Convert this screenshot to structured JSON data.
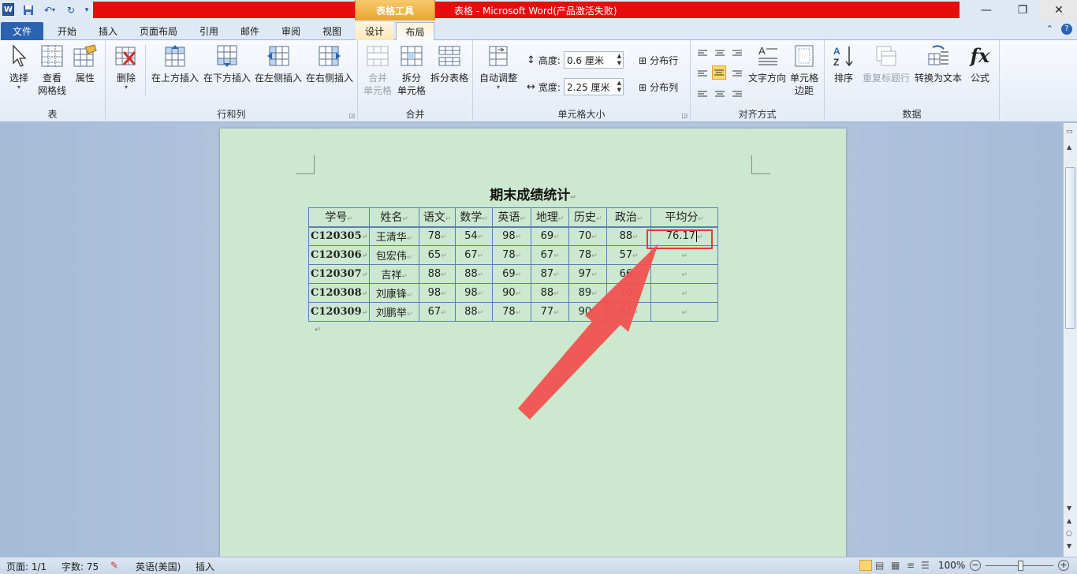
{
  "titlebar": {
    "logo": "W",
    "context_group": "表格工具",
    "window_title": "表格 - Microsoft Word(产品激活失败)",
    "minimize": "—",
    "restore": "❐",
    "close": "✕"
  },
  "tabs": {
    "file": "文件",
    "home": "开始",
    "insert": "插入",
    "page_layout": "页面布局",
    "references": "引用",
    "mailings": "邮件",
    "review": "审阅",
    "view": "视图",
    "design": "设计",
    "layout": "布局"
  },
  "ribbon": {
    "table_group": {
      "label": "表",
      "select": "选择",
      "gridlines_1": "查看",
      "gridlines_2": "网格线",
      "properties": "属性"
    },
    "rows_cols_group": {
      "label": "行和列",
      "delete": "删除",
      "insert_above": "在上方插入",
      "insert_below": "在下方插入",
      "insert_left": "在左侧插入",
      "insert_right": "在右侧插入"
    },
    "merge_group": {
      "label": "合并",
      "merge_1": "合并",
      "merge_2": "单元格",
      "split_1": "拆分",
      "split_2": "单元格",
      "split_table": "拆分表格"
    },
    "cell_size_group": {
      "label": "单元格大小",
      "autofit": "自动调整",
      "height_label": "高度:",
      "height_value": "0.6 厘米",
      "width_label": "宽度:",
      "width_value": "2.25 厘米",
      "distribute_rows": "分布行",
      "distribute_cols": "分布列"
    },
    "align_group": {
      "label": "对齐方式",
      "text_direction": "文字方向",
      "cell_margins_1": "单元格",
      "cell_margins_2": "边距"
    },
    "data_group": {
      "label": "数据",
      "sort": "排序",
      "repeat_header": "重复标题行",
      "convert_text": "转换为文本",
      "formula": "公式"
    }
  },
  "document": {
    "title": "期末成绩统计",
    "headers": [
      "学号",
      "姓名",
      "语文",
      "数学",
      "英语",
      "地理",
      "历史",
      "政治",
      "平均分"
    ],
    "rows": [
      [
        "C120305",
        "王清华",
        "78",
        "54",
        "98",
        "69",
        "70",
        "88",
        "76.17"
      ],
      [
        "C120306",
        "包宏伟",
        "65",
        "67",
        "78",
        "67",
        "78",
        "57",
        ""
      ],
      [
        "C120307",
        "吉祥",
        "88",
        "88",
        "69",
        "87",
        "97",
        "66",
        ""
      ],
      [
        "C120308",
        "刘康锋",
        "98",
        "98",
        "90",
        "88",
        "89",
        "70",
        ""
      ],
      [
        "C120309",
        "刘鹏举",
        "67",
        "88",
        "78",
        "77",
        "90",
        "67",
        ""
      ]
    ],
    "mark": "↵"
  },
  "status": {
    "page": "页面: 1/1",
    "words": "字数: 75",
    "language": "英语(美国)",
    "mode": "插入",
    "zoom": "100%"
  },
  "colors": {
    "arrow": "#f0524f",
    "highlight": "#e23b3b",
    "page_bg": "#cce8cf",
    "redbar": "#e60d0d"
  }
}
